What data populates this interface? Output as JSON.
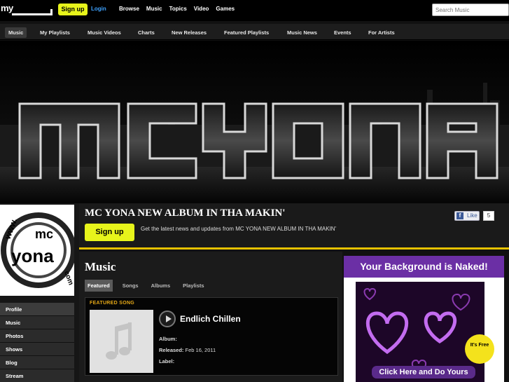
{
  "topbar": {
    "logo_text": "my",
    "signup": "Sign up",
    "login": "Login",
    "nav": [
      "Browse",
      "Music",
      "Topics",
      "Video",
      "Games"
    ],
    "search_placeholder": "Search Music"
  },
  "musicnav": [
    "Music",
    "My Playlists",
    "Music Videos",
    "Charts",
    "New Releases",
    "Featured Playlists",
    "Music News",
    "Events",
    "For Artists"
  ],
  "banner": {
    "text": "MCYONA"
  },
  "profile_image_text": {
    "line1": "www.",
    "line2": "mc",
    "line3": "yona",
    "line4": "com"
  },
  "leftnav": [
    "Profile",
    "Music",
    "Photos",
    "Shows",
    "Blog",
    "Stream"
  ],
  "header": {
    "title": "MC YONA NEW ALBUM IN THA MAKIN'",
    "signup": "Sign up",
    "desc": "Get the latest news and updates from MC YONA NEW ALBUM IN THA MAKIN'",
    "like": "Like",
    "like_count": "5"
  },
  "music": {
    "title": "Music",
    "tabs": [
      "Featured",
      "Songs",
      "Albums",
      "Playlists"
    ],
    "featured_label": "FEATURED SONG",
    "song_title": "Endlich Chillen",
    "album_label": "Album:",
    "album_value": "",
    "released_label": "Released:",
    "released_value": "Feb 16, 2011",
    "label_label": "Label:",
    "label_value": ""
  },
  "ad": {
    "headline": "Your Background is Naked!",
    "badge": "It's Free",
    "cta": "Click Here and Do Yours"
  }
}
